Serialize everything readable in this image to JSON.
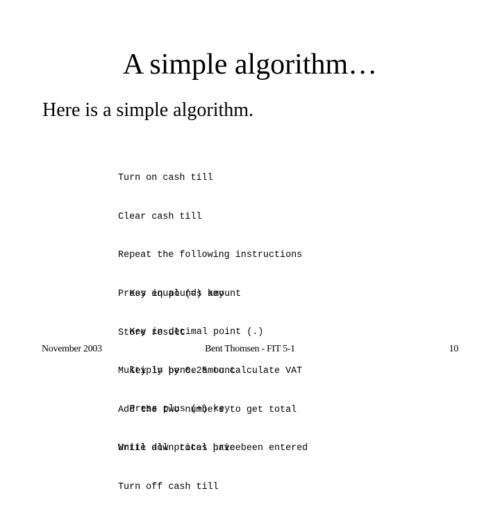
{
  "slide": {
    "title": "A simple algorithm…",
    "intro": "Here is a simple algorithm.",
    "code_blocks": [
      {
        "lines": [
          {
            "text": "Turn on cash till",
            "indent": false
          },
          {
            "text": "Clear cash till",
            "indent": false
          },
          {
            "text": "Repeat the following instructions",
            "indent": false
          },
          {
            "text": "Key in pounds amount",
            "indent": true
          },
          {
            "text": "Key in decimal point (.)",
            "indent": true
          },
          {
            "text": "Key in pence amount",
            "indent": true
          },
          {
            "text": "Press plus (+) key",
            "indent": true
          },
          {
            "text": "Until all prices have been entered",
            "indent": false
          }
        ]
      },
      {
        "lines": [
          {
            "text": "Press equal (=) key",
            "indent": false
          },
          {
            "text": "Store result",
            "indent": false
          },
          {
            "text": "Multiply by 0.25 to calculate VAT",
            "indent": false
          },
          {
            "text": "Add the two numbers to get total",
            "indent": false
          },
          {
            "text": "Write down total price",
            "indent": false
          },
          {
            "text": "Turn off cash till",
            "indent": false
          }
        ]
      }
    ],
    "footer": {
      "date": "November 2003",
      "author": "Bent Thomsen - FIT 5-1",
      "page_number": "10"
    }
  }
}
